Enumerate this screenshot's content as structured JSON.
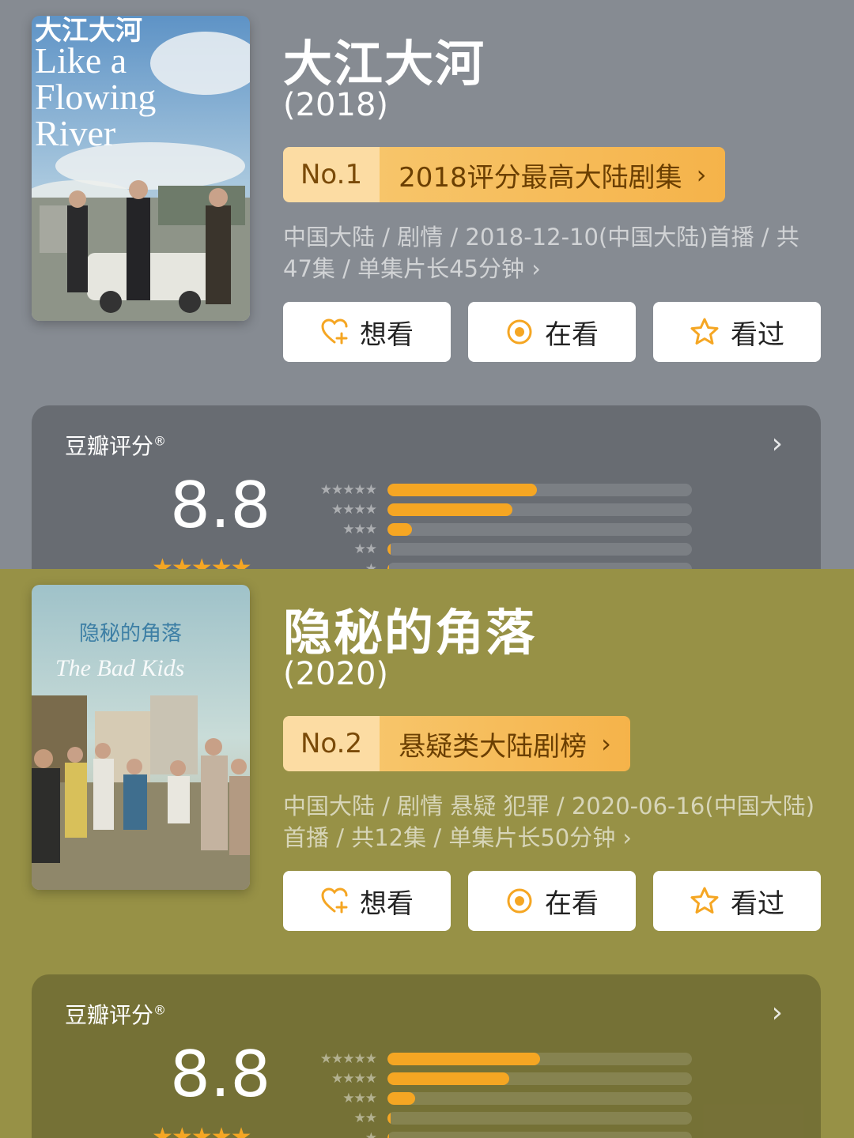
{
  "panels": [
    {
      "title": "大江大河",
      "year": "(2018)",
      "rank": {
        "no": "No.1",
        "text": "2018评分最高大陆剧集"
      },
      "meta": "中国大陆 / 剧情 / 2018-12-10(中国大陆)首播 / 共47集 / 单集片长45分钟 ›",
      "poster": {
        "lines": [
          "大江大河",
          "Like a",
          "Flowing",
          "River"
        ]
      },
      "actions": {
        "want": "想看",
        "watching": "在看",
        "watched": "看过"
      },
      "rating": {
        "label": "豆瓣评分",
        "score": "8.8",
        "stars": 4.5,
        "distribution": [
          0.49,
          0.41,
          0.08,
          0.01,
          0.005
        ]
      }
    },
    {
      "title": "隐秘的角落",
      "year": "(2020)",
      "rank": {
        "no": "No.2",
        "text": "悬疑类大陆剧榜"
      },
      "meta": "中国大陆 / 剧情 悬疑 犯罪 / 2020-06-16(中国大陆)首播 / 共12集 / 单集片长50分钟 ›",
      "poster": {
        "lines": [
          "隐秘的角落",
          "The Bad Kids"
        ]
      },
      "actions": {
        "want": "想看",
        "watching": "在看",
        "watched": "看过"
      },
      "rating": {
        "label": "豆瓣评分",
        "score": "8.8",
        "stars": 4.5,
        "distribution": [
          0.5,
          0.4,
          0.09,
          0.01,
          0.005
        ]
      }
    }
  ],
  "colors": {
    "panel1_bg": "#868b92",
    "panel2_bg": "#979146",
    "accent": "#f5a623",
    "rank_light": "#fcdca3"
  },
  "icons": [
    "heart-plus-icon",
    "target-circle-icon",
    "star-outline-icon",
    "chevron-right-icon"
  ]
}
